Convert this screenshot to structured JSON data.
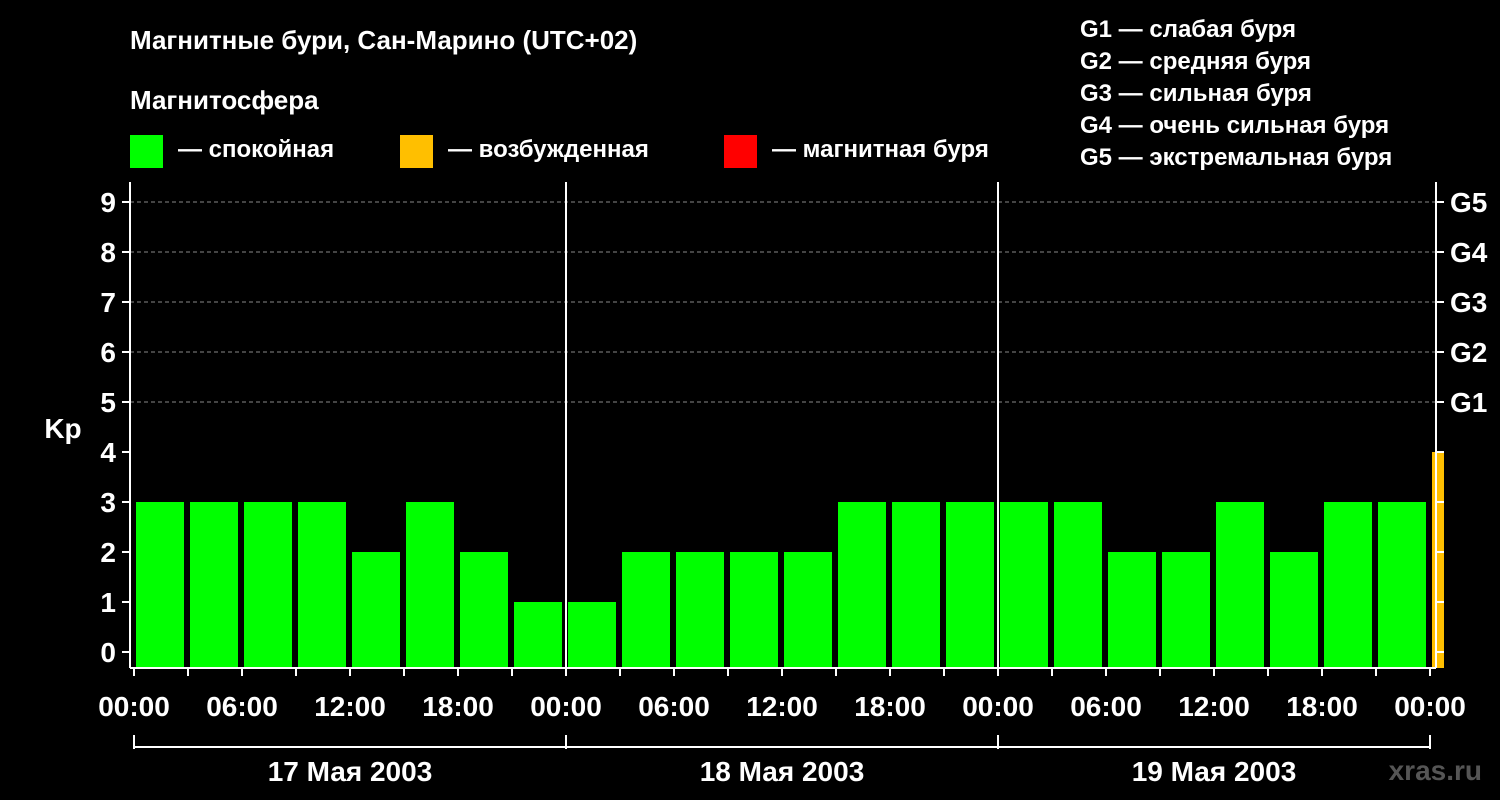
{
  "header": {
    "title": "Магнитные бури, Сан-Марино (UTC+02)",
    "subtitle": "Магнитосфера"
  },
  "legend": {
    "items": [
      {
        "label": "— спокойная",
        "color": "#00ff00"
      },
      {
        "label": "— возбужденная",
        "color": "#ffbf00"
      },
      {
        "label": "— магнитная буря",
        "color": "#ff0000"
      }
    ],
    "g_scale": [
      "G1 — слабая буря",
      "G2 — средняя буря",
      "G3 — сильная буря",
      "G4 — очень сильная буря",
      "G5 — экстремальная буря"
    ]
  },
  "watermark": "xras.ru",
  "chart_data": {
    "type": "bar",
    "ylabel": "Kp",
    "ylim": [
      0,
      9
    ],
    "yticks": [
      "0",
      "1",
      "2",
      "3",
      "4",
      "5",
      "6",
      "7",
      "8",
      "9"
    ],
    "right_ticks": [
      {
        "label": "G1",
        "kp": 5
      },
      {
        "label": "G2",
        "kp": 6
      },
      {
        "label": "G3",
        "kp": 7
      },
      {
        "label": "G4",
        "kp": 8
      },
      {
        "label": "G5",
        "kp": 9
      }
    ],
    "xticks": [
      "00:00",
      "06:00",
      "12:00",
      "18:00",
      "00:00",
      "06:00",
      "12:00",
      "18:00",
      "00:00",
      "06:00",
      "12:00",
      "18:00",
      "00:00"
    ],
    "days": [
      "17 Мая 2003",
      "18 Мая 2003",
      "19 Мая 2003"
    ],
    "interval_hours": 3,
    "x_start": "17 Мая 2003 00:00",
    "values": [
      3,
      3,
      3,
      3,
      2,
      3,
      2,
      1,
      1,
      2,
      2,
      2,
      2,
      3,
      3,
      3,
      3,
      3,
      2,
      2,
      3,
      2,
      3,
      3,
      4
    ],
    "last_bar_partial": true,
    "colors": {
      "quiet": "#00ff00",
      "active": "#ffbf00",
      "storm": "#ff0000"
    },
    "grid": "dashed horizontal at Kp 5–9"
  }
}
